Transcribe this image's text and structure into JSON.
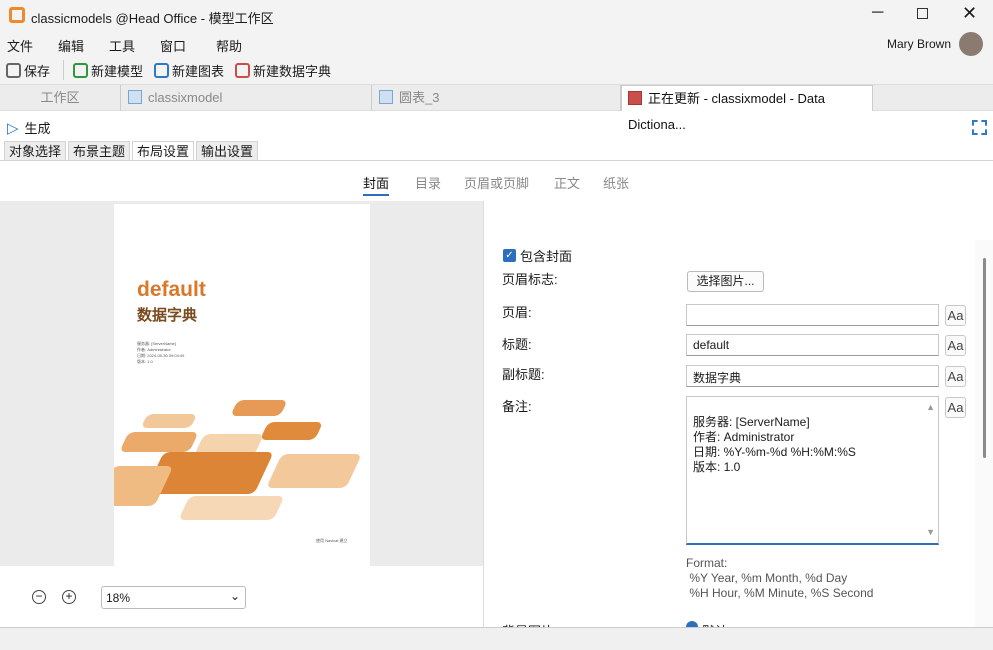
{
  "window": {
    "title": "classicmodels @Head Office - 模型工作区",
    "user": "Mary Brown"
  },
  "menu": [
    "文件",
    "编辑",
    "工具",
    "窗口",
    "帮助"
  ],
  "toolbar": {
    "save": "保存",
    "new_model": "新建模型",
    "new_diagram": "新建图表",
    "new_dictionary": "新建数据字典"
  },
  "tabs": [
    {
      "label": "工作区"
    },
    {
      "label": "classixmodel"
    },
    {
      "label": "圆表_3"
    },
    {
      "label": "正在更新 - classixmodel - Data Dictiona..."
    }
  ],
  "generate": "生成",
  "subtabs": [
    "对象选择",
    "布景主题",
    "布局设置",
    "输出设置"
  ],
  "sections": [
    "封面",
    "目录",
    "页眉或页脚",
    "正文",
    "纸张"
  ],
  "preview": {
    "title": "default",
    "subtitle": "数据字典",
    "lines": [
      "服务器: [ServerName]",
      "作者: Administrator",
      "日期: 2024-05-30 09:04:49",
      "版本: 1.0"
    ],
    "footer": "使用 Navicat 建立",
    "zoom": "18%"
  },
  "form": {
    "include_cover": "包含封面",
    "include_cover_checked": true,
    "logo_label": "页眉标志:",
    "logo_button": "选择图片...",
    "header_label": "页眉:",
    "header_value": "",
    "title_label": "标题:",
    "title_value": "default",
    "subtitle_label": "副标题:",
    "subtitle_value": "数据字典",
    "notes_label": "备注:",
    "notes_value": "服务器: [ServerName]\n作者: Administrator\n日期: %Y-%m-%d %H:%M:%S\n版本: 1.0",
    "font_button": "Aa",
    "format_title": "Format:",
    "format_line1": " %Y Year, %m Month, %d Day",
    "format_line2": " %H Hour, %M Minute, %S Second",
    "bg_label": "背景图片",
    "bg_option": "默认"
  },
  "colors": {
    "accent": "#2e6fbd",
    "cover_orange": "#d9782a"
  }
}
